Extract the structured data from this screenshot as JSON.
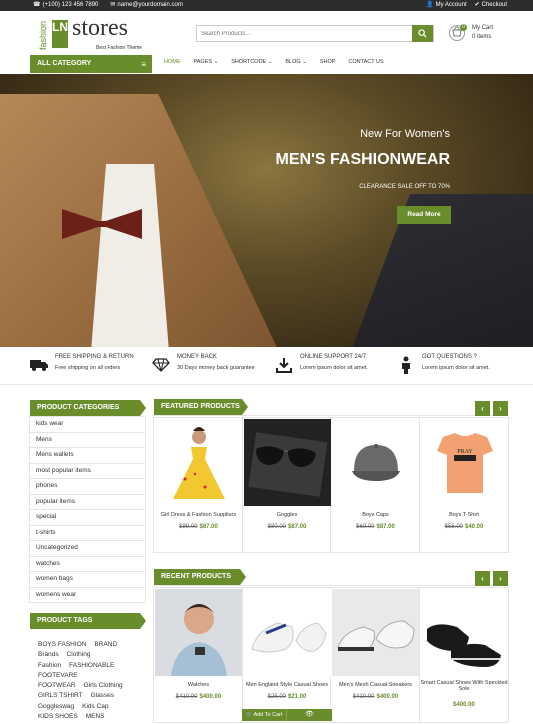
{
  "topbar": {
    "phone": "(+100) 123 456 7890",
    "email": "name@yourdomain.com",
    "account": "My Account",
    "checkout": "Checkout"
  },
  "logo": {
    "side": "fashion",
    "letters": "LN",
    "word": "stores",
    "tagline": "Best Fashion Theme"
  },
  "search": {
    "placeholder": "Search Products..."
  },
  "cart": {
    "title": "My Cart",
    "items": "0 items",
    "count": "0"
  },
  "all_category": "ALL CATEGORY",
  "nav": [
    "HOME",
    "PAGES",
    "SHORTCODE",
    "BLOG",
    "SHOP",
    "CONTACT US"
  ],
  "hero": {
    "line1": "New For Women's",
    "line2": "MEN'S FASHIONWEAR",
    "line3": "CLEARANCE SALE OFF TO 70%",
    "button": "Read More"
  },
  "features": [
    {
      "icon": "truck-icon",
      "title": "FREE SHIPPING & RETURN",
      "sub": "Free shipping on all orders"
    },
    {
      "icon": "diamond-icon",
      "title": "MONEY BACK",
      "sub": "30 Days money back guarantee"
    },
    {
      "icon": "download-icon",
      "title": "ONLINE SUPPORT 24/7",
      "sub": "Lorem ipsum dolor sit amet."
    },
    {
      "icon": "person-icon",
      "title": "GOT QUESTIONS ?",
      "sub": "Lorem ipsum dolor sit amet."
    }
  ],
  "categories": {
    "title": "PRODUCT CATEGORIES",
    "items": [
      "kids wear",
      "Mens",
      "Mens wallets",
      "most popular items",
      "phones",
      "popular items",
      "special",
      "t-shirts",
      "Uncategorized",
      "watches",
      "women bags",
      "womens wear"
    ]
  },
  "tags": {
    "title": "PRODUCT TAGS",
    "items": [
      "BOYS FASHION",
      "BRAND",
      "Brands",
      "Clothing",
      "Fashion",
      "FASHIONABLE",
      "FOOTEVARE",
      "FOOTWEAR",
      "Girls Clothing",
      "GIRLS TSHIRT",
      "Glasses",
      "Goggleswag",
      "Kids Cap",
      "KIDS SHOES",
      "MENS"
    ]
  },
  "featured": {
    "title": "FEATURED PRODUCTS",
    "products": [
      {
        "name": "Girl Dress & Fashion Suppliers",
        "old": "$89.00",
        "new": "$87.00"
      },
      {
        "name": "Goggles",
        "old": "$80.00",
        "new": "$87.00"
      },
      {
        "name": "Boys Caps",
        "old": "$69.00",
        "new": "$87.00"
      },
      {
        "name": "Boys T-Shirt",
        "old": "$55.00",
        "new": "$40.00"
      }
    ]
  },
  "recent": {
    "title": "RECENT PRODUCTS",
    "add_to_cart": "Add To Cart",
    "products": [
      {
        "name": "Watches",
        "old": "$410.00",
        "new": "$400.00"
      },
      {
        "name": "Men England Style Casual Shoes",
        "old": "$25.00",
        "new": "$21.00"
      },
      {
        "name": "Men's Mesh Casual Sneakers",
        "old": "$410.00",
        "new": "$400.00"
      },
      {
        "name": "Smart Casual Shoes With Speckled Sole",
        "old": "",
        "new": "$400.00"
      }
    ]
  },
  "colors": {
    "accent": "#6a8d2c",
    "topbar": "#2d2d2d"
  }
}
